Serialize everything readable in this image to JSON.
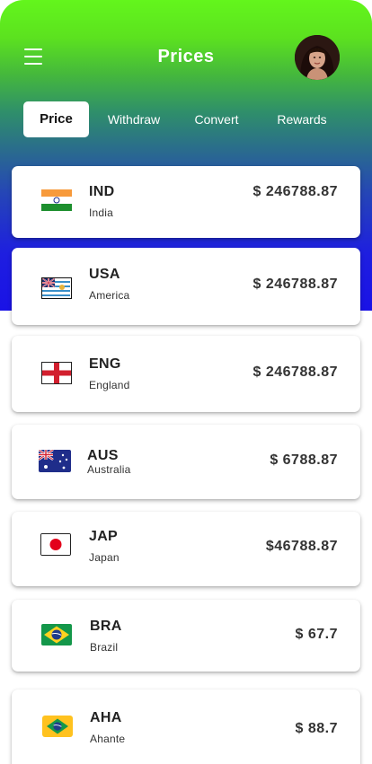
{
  "header": {
    "title": "Prices",
    "menu_icon": "menu-icon",
    "avatar_icon": "user-avatar"
  },
  "tabs": [
    {
      "label": "Price",
      "active": true
    },
    {
      "label": "Withdraw",
      "active": false
    },
    {
      "label": "Convert",
      "active": false
    },
    {
      "label": "Rewards",
      "active": false
    }
  ],
  "currencies": [
    {
      "code": "IND",
      "name": "India",
      "price": "$ 246788.87",
      "flag": "india-flag"
    },
    {
      "code": "USA",
      "name": "America",
      "price": "$ 246788.87",
      "flag": "usa-flag"
    },
    {
      "code": "ENG",
      "name": "England",
      "price": "$ 246788.87",
      "flag": "england-flag"
    },
    {
      "code": "AUS",
      "name": "Australia",
      "price": "$ 6788.87",
      "flag": "australia-flag"
    },
    {
      "code": "JAP",
      "name": "Japan",
      "price": "$46788.87",
      "flag": "japan-flag"
    },
    {
      "code": "BRA",
      "name": "Brazil",
      "price": "$ 67.7",
      "flag": "brazil-flag"
    },
    {
      "code": "AHA",
      "name": "Ahante",
      "price": "$ 88.7",
      "flag": "brazil-flag"
    }
  ],
  "colors": {
    "gradient_top": "#63f61c",
    "gradient_bottom": "#1a12e6"
  }
}
